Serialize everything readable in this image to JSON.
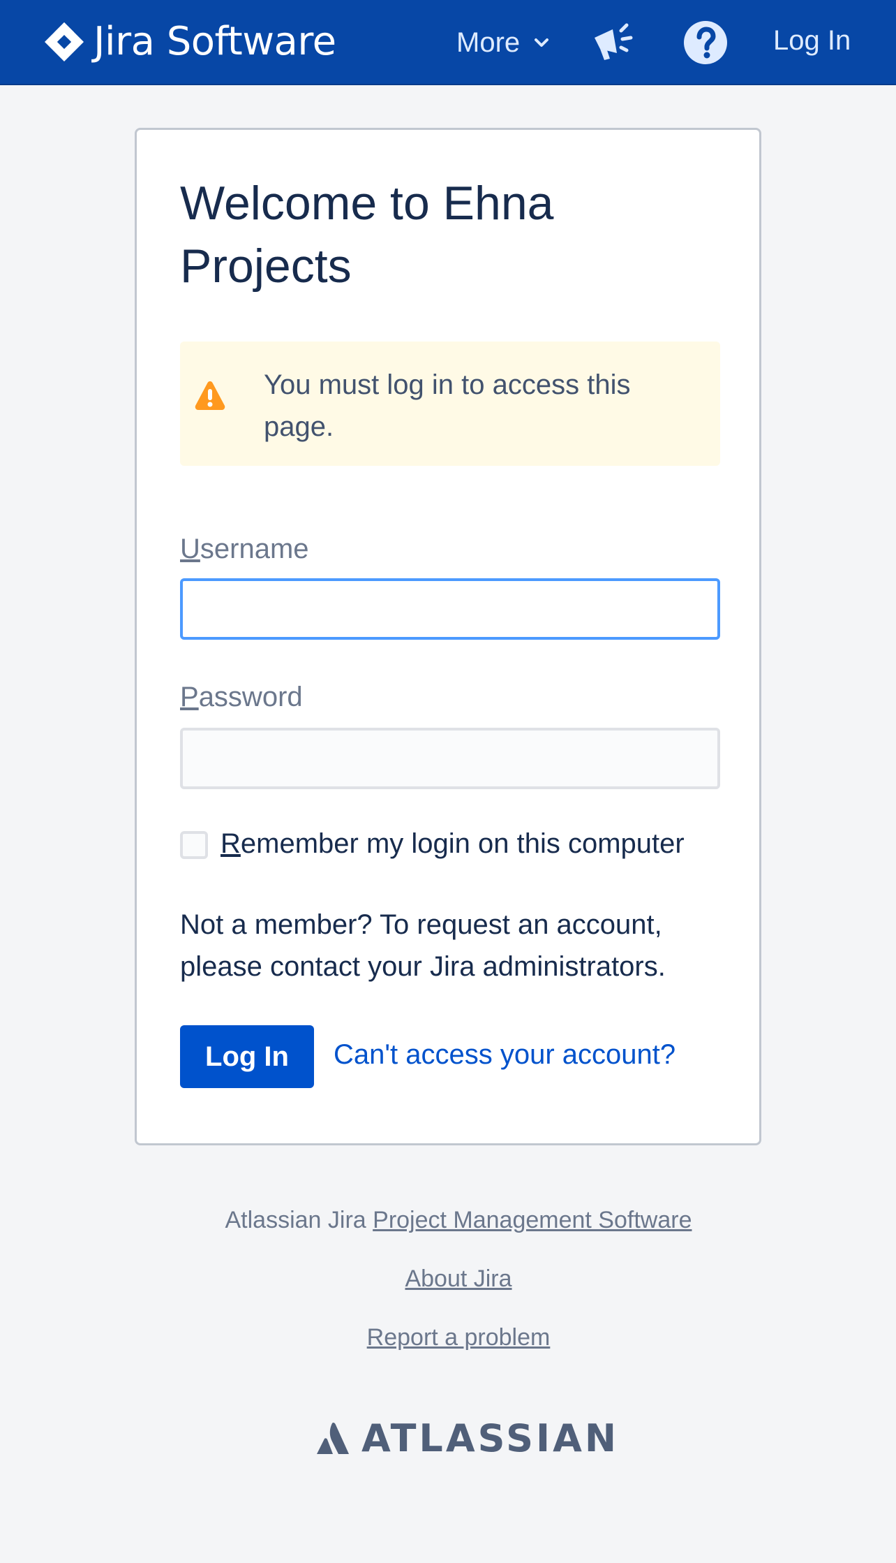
{
  "header": {
    "product_name": "Jira Software",
    "more_label": "More",
    "login_label": "Log In"
  },
  "login_card": {
    "title": "Welcome to Ehna Projects",
    "warning": "You must log in to access this page.",
    "username_label_access_key": "U",
    "username_label_rest": "sername",
    "username_value": "",
    "password_label_access_key": "P",
    "password_label_rest": "assword",
    "password_value": "",
    "remember_access_key": "R",
    "remember_rest": "emember my login on this computer",
    "remember_checked": false,
    "member_text": "Not a member? To request an account, please contact your Jira administrators.",
    "login_button": "Log In",
    "cant_access_link": "Can't access your account?"
  },
  "footer": {
    "prefix": "Atlassian Jira ",
    "pm_software_link": "Project Management Software",
    "about_link": "About Jira",
    "report_link": "Report a problem",
    "brand": "ATLASSIAN"
  },
  "colors": {
    "header_bg": "#0747a6",
    "primary": "#0052cc",
    "warning_bg": "#fffae6",
    "warning_icon": "#ff991f",
    "focus_border": "#4c9aff",
    "page_bg": "#f4f5f7"
  },
  "icons": {
    "logo": "jira-diamond-icon",
    "more": "chevron-down-icon",
    "announce": "megaphone-icon",
    "help": "question-circle-icon",
    "warning": "warning-triangle-icon",
    "brand": "atlassian-logo-icon"
  }
}
